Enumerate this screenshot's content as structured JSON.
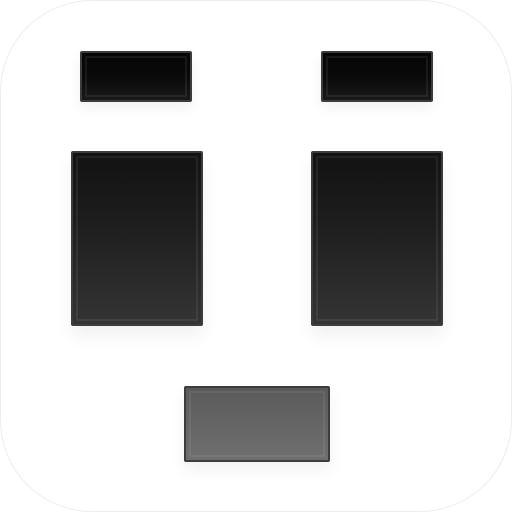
{
  "app_icon": {
    "name": "face-app-icon",
    "background_color": "#ffffff",
    "colors": {
      "brows": "#0a0a0a",
      "eyes": "#222222",
      "mouth": "#666666",
      "block_border": "#3c3c3c"
    }
  }
}
